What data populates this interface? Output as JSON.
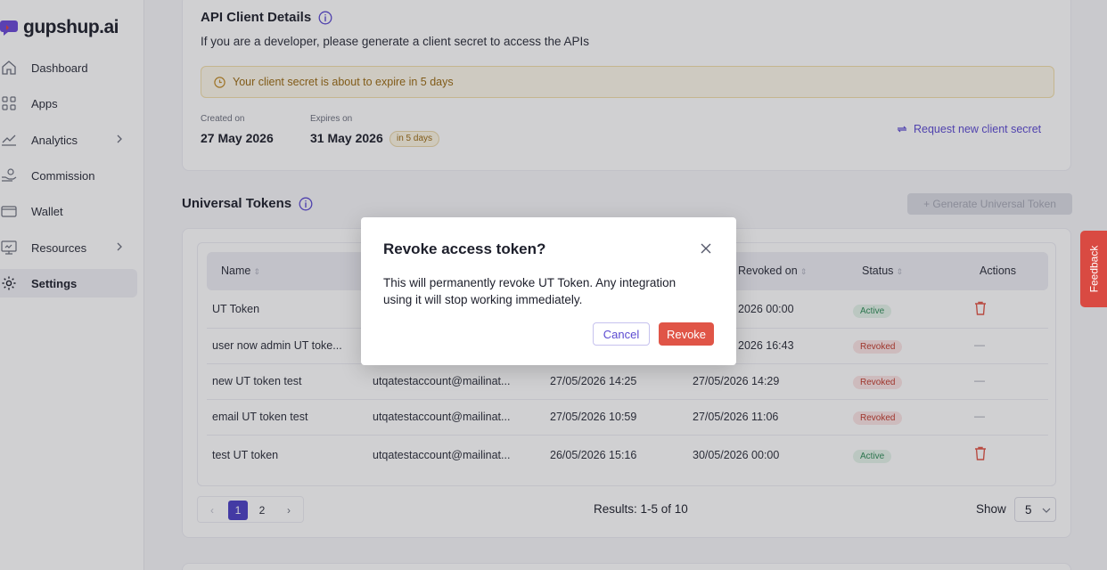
{
  "brand": {
    "name": "gupshup.ai"
  },
  "sidebar": {
    "items": [
      {
        "label": "Dashboard",
        "icon": "home-icon"
      },
      {
        "label": "Apps",
        "icon": "grid-icon"
      },
      {
        "label": "Analytics",
        "icon": "chart-icon"
      },
      {
        "label": "Commission",
        "icon": "coins-hand-icon"
      },
      {
        "label": "Wallet",
        "icon": "wallet-icon"
      },
      {
        "label": "Resources",
        "icon": "book-icon"
      },
      {
        "label": "Settings",
        "icon": "gear-icon"
      }
    ]
  },
  "api_details": {
    "title": "API Client Details",
    "subtitle": "If you are a developer, please generate a client secret to access the APIs",
    "warning": "Your client secret is about to expire in 5 days",
    "created_label": "Created on",
    "created_value": "27 May 2026",
    "expires_label": "Expires on",
    "expires_value": "31 May 2026",
    "expires_badge": "in 5 days",
    "request_link": "Request new client secret"
  },
  "universal_tokens": {
    "title": "Universal Tokens",
    "generate_button": "+ Generate Universal Token",
    "columns": {
      "name": "Name",
      "revoked_on": "Revoked on",
      "status": "Status",
      "actions": "Actions"
    },
    "rows": [
      {
        "name": "UT Token",
        "email": "",
        "created": "",
        "revoked": "2026 00:00",
        "status": "Active",
        "action": "delete"
      },
      {
        "name": "user now admin UT toke...",
        "email": "",
        "created": "",
        "revoked": "2026 16:43",
        "status": "Revoked",
        "action": "—"
      },
      {
        "name": "new UT token test",
        "email": "utqatestaccount@mailinat...",
        "created": "27/05/2026 14:25",
        "revoked": "27/05/2026 14:29",
        "status": "Revoked",
        "action": "—"
      },
      {
        "name": "email UT token test",
        "email": "utqatestaccount@mailinat...",
        "created": "27/05/2026 10:59",
        "revoked": "27/05/2026 11:06",
        "status": "Revoked",
        "action": "—"
      },
      {
        "name": "test UT token",
        "email": "utqatestaccount@mailinat...",
        "created": "26/05/2026 15:16",
        "revoked": "30/05/2026 00:00",
        "status": "Active",
        "action": "delete"
      }
    ],
    "pagination": {
      "pages": [
        "1",
        "2"
      ],
      "current": "1",
      "results": "Results: 1-5 of 10",
      "show_label": "Show",
      "page_size": "5"
    }
  },
  "modal": {
    "title": "Revoke access token?",
    "body": "This will permanently revoke UT Token. Any integration using it will stop working immediately.",
    "cancel": "Cancel",
    "confirm": "Revoke"
  },
  "feedback": {
    "label": "Feedback"
  },
  "colors": {
    "accent": "#5b4ad1",
    "danger": "#e05547",
    "warning_bg": "#fdf8e9"
  }
}
